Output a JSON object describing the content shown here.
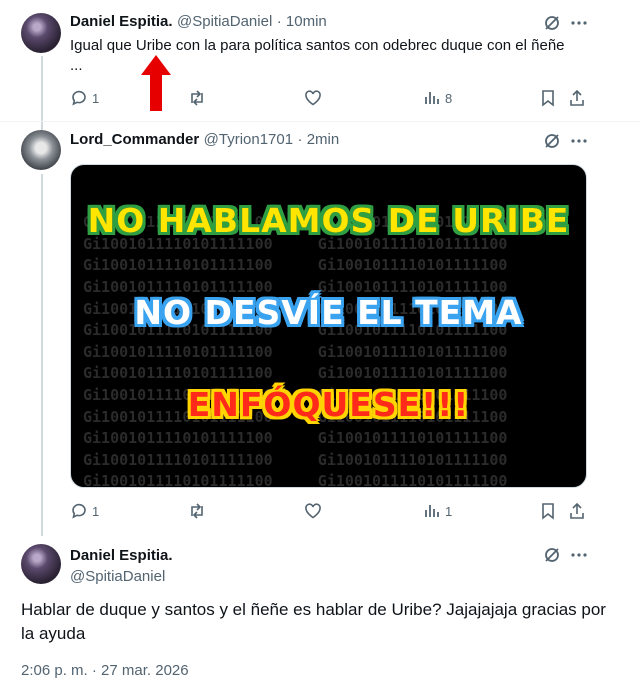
{
  "reply1": {
    "name": "Daniel Espitia.",
    "handle": "@SpitiaDaniel",
    "time": "· 10min",
    "text": "Igual que Uribe con la para política santos con odebrec duque con el ñeñe",
    "more": "...",
    "replies": "1",
    "views": "8"
  },
  "reply2": {
    "name": "Lord_Commander",
    "handle": "@Tyrion1701",
    "time": "· 2min",
    "replies": "1",
    "views": "1",
    "image": {
      "line1": "NO HABLAMOS DE URIBE",
      "line2": "NO DESVÍE EL TEMA",
      "line3": "ENFÓQUESE!!!",
      "background_pattern": "Gi1001011110101111100     Gi1001011110101111100"
    }
  },
  "main": {
    "name": "Daniel Espitia.",
    "handle": "@SpitiaDaniel",
    "text": "Hablar de duque y santos y el ñeñe es hablar de Uribe? Jajajajaja gracias por la ayuda",
    "timestamp": "2:06 p. m. · 27 mar. 2026"
  },
  "colors": {
    "text": "#0f1419",
    "muted": "#536471",
    "arrow": "#e60000"
  }
}
